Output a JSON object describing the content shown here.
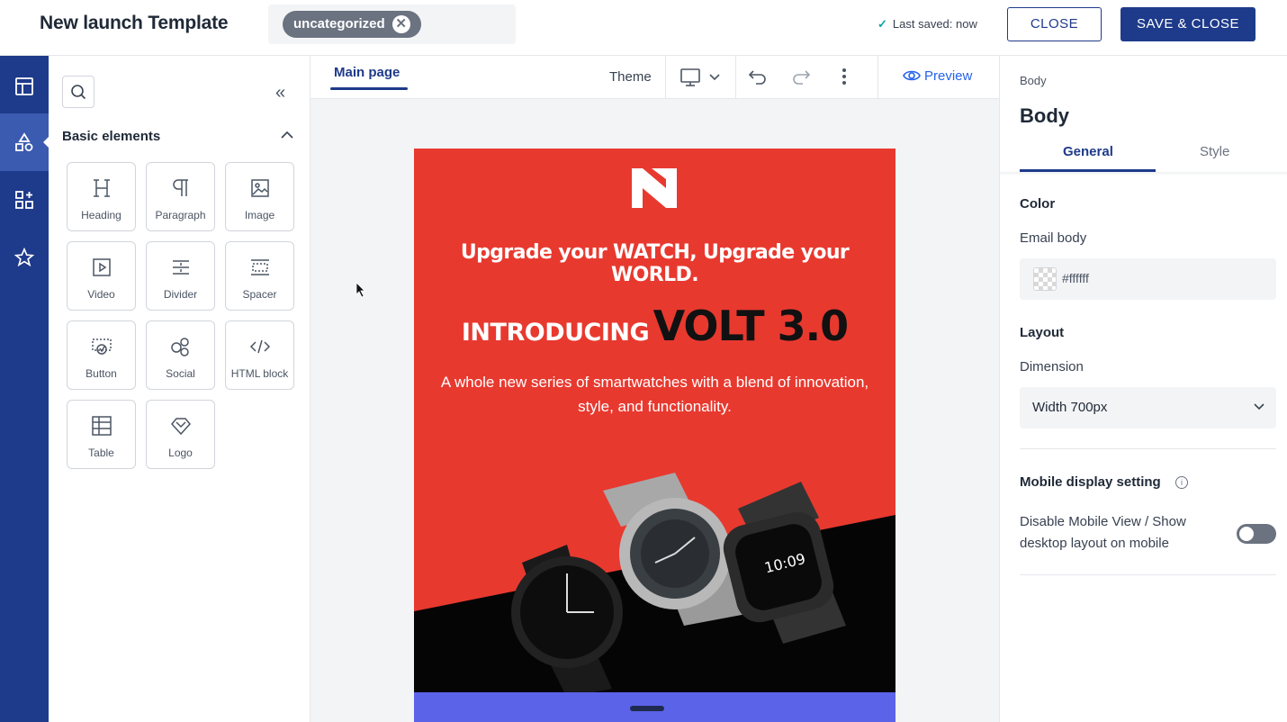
{
  "header": {
    "title": "New launch Template",
    "tag": "uncategorized",
    "saved_status": "Last saved: now",
    "close_label": "CLOSE",
    "save_close_label": "SAVE & CLOSE"
  },
  "elements_panel": {
    "section_title": "Basic elements",
    "items": [
      {
        "label": "Heading",
        "icon": "heading-icon"
      },
      {
        "label": "Paragraph",
        "icon": "paragraph-icon"
      },
      {
        "label": "Image",
        "icon": "image-icon"
      },
      {
        "label": "Video",
        "icon": "video-icon"
      },
      {
        "label": "Divider",
        "icon": "divider-icon"
      },
      {
        "label": "Spacer",
        "icon": "spacer-icon"
      },
      {
        "label": "Button",
        "icon": "button-icon"
      },
      {
        "label": "Social",
        "icon": "social-icon"
      },
      {
        "label": "HTML block",
        "icon": "code-icon"
      },
      {
        "label": "Table",
        "icon": "table-icon"
      },
      {
        "label": "Logo",
        "icon": "logo-icon"
      }
    ]
  },
  "canvas": {
    "tab": "Main page",
    "theme_label": "Theme",
    "preview_label": "Preview"
  },
  "email": {
    "headline": "Upgrade your WATCH, Upgrade your WORLD.",
    "intro_prefix": "INTRODUCING",
    "intro_product": "VOLT 3.0",
    "description": "A whole new series of smartwatches with a blend of innovation, style, and functionality.",
    "watch_time": "10:09",
    "bg_color": "#e8392f"
  },
  "properties": {
    "breadcrumb": "Body",
    "title": "Body",
    "tabs": [
      "General",
      "Style"
    ],
    "color_section": "Color",
    "email_body_label": "Email body",
    "email_body_color": "#ffffff",
    "layout_section": "Layout",
    "dimension_label": "Dimension",
    "dimension_value": "Width 700px",
    "mobile_section": "Mobile display setting",
    "mobile_toggle_label": "Disable Mobile View / Show desktop layout on mobile",
    "mobile_toggle_on": false
  },
  "colors": {
    "brand": "#1e3a8a",
    "accent": "#2563eb"
  }
}
